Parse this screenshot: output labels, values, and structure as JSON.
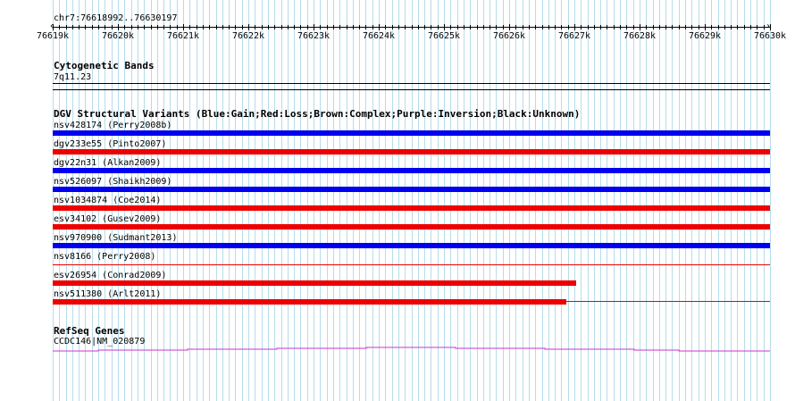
{
  "ruler": {
    "position": "chr7:76618992..76630197",
    "tick_labels": [
      "76619k",
      "76620k",
      "76621k",
      "76622k",
      "76623k",
      "76624k",
      "76625k",
      "76626k",
      "76627k",
      "76628k",
      "76629k",
      "76630k"
    ]
  },
  "cytoband": {
    "title": "Cytogenetic Bands",
    "band": "7q11.23"
  },
  "dgv": {
    "title": "DGV Structural Variants (Blue:Gain;Red:Loss;Brown:Complex;Purple:Inversion;Black:Unknown)",
    "colors": {
      "gain": "#0000ee",
      "loss": "#ee0000"
    },
    "variants": [
      {
        "label": "nsv428174 (Perry2008b)",
        "type": "gain",
        "end_kb": 76630.197
      },
      {
        "label": "dgv233e55 (Pinto2007)",
        "type": "loss",
        "end_kb": 76630.197
      },
      {
        "label": "dgv22n31 (Alkan2009)",
        "type": "gain",
        "end_kb": 76630.197
      },
      {
        "label": "nsv526097 (Shaikh2009)",
        "type": "gain",
        "end_kb": 76630.197
      },
      {
        "label": "nsv1034874 (Coe2014)",
        "type": "loss",
        "end_kb": 76630.197
      },
      {
        "label": "esv34102 (Gusev2009)",
        "type": "loss",
        "end_kb": 76630.197
      },
      {
        "label": "nsv970900 (Sudmant2013)",
        "type": "gain",
        "end_kb": 76630.197
      },
      {
        "label": "nsv8166 (Perry2008)",
        "type": "loss",
        "end_kb": 76630.197,
        "thin": true
      },
      {
        "label": "esv26954 (Conrad2009)",
        "type": "loss",
        "end_kb": 76627.03
      },
      {
        "label": "nsv511380 (Arlt2011)",
        "type": "loss",
        "end_kb": 76626.88,
        "thin_tail": true
      }
    ]
  },
  "refseq": {
    "title": "RefSeq Genes",
    "gene": "CCDC146|NM_020879",
    "color": "#cc33cc"
  }
}
